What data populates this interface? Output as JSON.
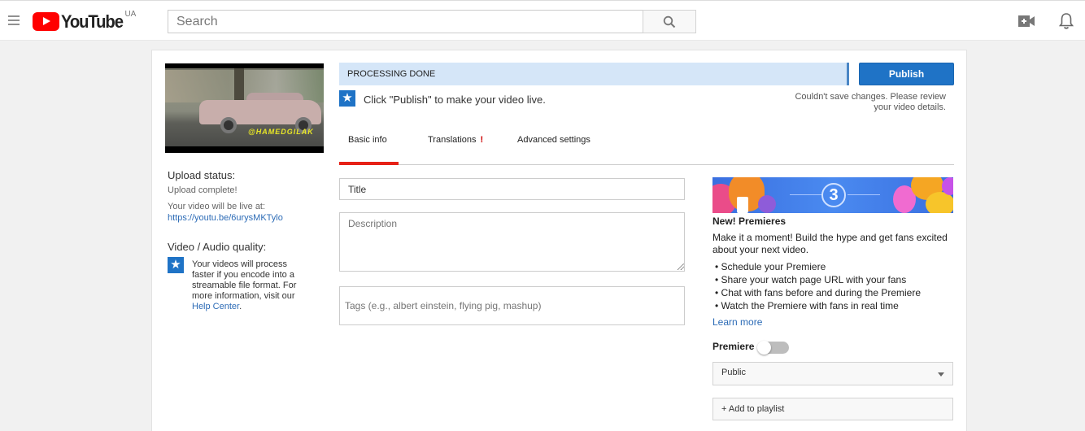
{
  "header": {
    "brand": "YouTube",
    "country_code": "UA",
    "search_placeholder": "Search",
    "icons": [
      "menu-icon",
      "search-icon",
      "create-video-icon",
      "notifications-bell-icon"
    ]
  },
  "sidebar": {
    "thumbnail_watermark": "@HAMEDGILAK",
    "upload_status_heading": "Upload status:",
    "upload_status_text": "Upload complete!",
    "live_at_label": "Your video will be live at:",
    "live_url": "https://youtu.be/6urysMKTylo",
    "quality_heading": "Video / Audio quality:",
    "quality_text": "Your videos will process faster if you encode into a streamable file format. For more information, visit our ",
    "help_center_link": "Help Center",
    "quality_text_end": "."
  },
  "status": {
    "processing_label": "PROCESSING DONE",
    "processing_progress_percent": 100,
    "publish_button": "Publish",
    "hint": "Click \"Publish\" to make your video live.",
    "save_error": "Couldn't save changes. Please review your video details."
  },
  "tabs": [
    {
      "label": "Basic info",
      "active": true
    },
    {
      "label": "Translations",
      "warning": "!"
    },
    {
      "label": "Advanced settings"
    }
  ],
  "form": {
    "title_value": "Title",
    "description_placeholder": "Description",
    "tags_placeholder": "Tags (e.g., albert einstein, flying pig, mashup)"
  },
  "premieres": {
    "banner_number": "3",
    "heading": "New! Premieres",
    "description": "Make it a moment! Build the hype and get fans excited about your next video.",
    "bullets": [
      "Schedule your Premiere",
      "Share your watch page URL with your fans",
      "Chat with fans before and during the Premiere",
      "Watch the Premiere with fans in real time"
    ],
    "learn_more": "Learn more",
    "toggle_label": "Premiere",
    "toggle_on": false
  },
  "privacy": {
    "selected": "Public"
  },
  "playlist_button": "+ Add to playlist",
  "colors": {
    "brand_red": "#ff0000",
    "accent_blue": "#1f73c6",
    "processing_bg": "#d5e6f8",
    "tab_underline": "#e62117",
    "link": "#2c6bb6"
  }
}
